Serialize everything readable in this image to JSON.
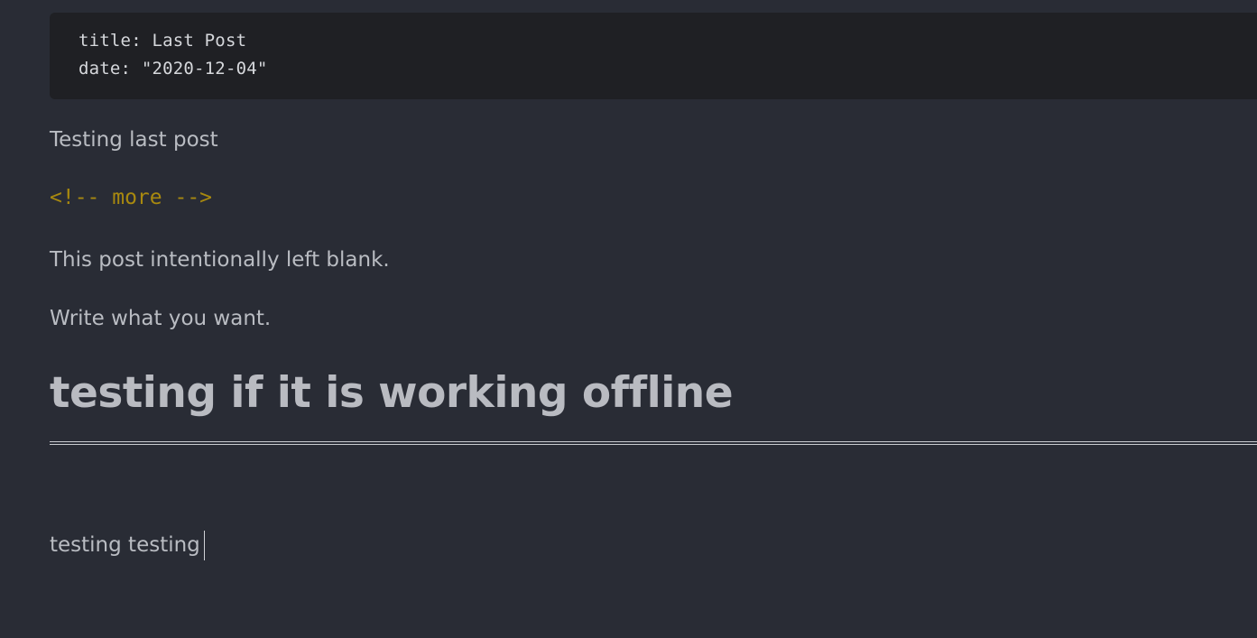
{
  "frontmatter": {
    "line1": "title: Last Post",
    "line2": "date: \"2020-12-04\""
  },
  "content": {
    "paragraph1": "Testing last post",
    "more_comment": "<!-- more -->",
    "paragraph2": "This post intentionally left blank.",
    "paragraph3": "Write what you want.",
    "heading": "testing if it is working offline",
    "paragraph4": "testing testing"
  },
  "colors": {
    "background": "#292c35",
    "code_background": "#1f2024",
    "text": "#b9bcc2",
    "comment": "#a8890f"
  }
}
